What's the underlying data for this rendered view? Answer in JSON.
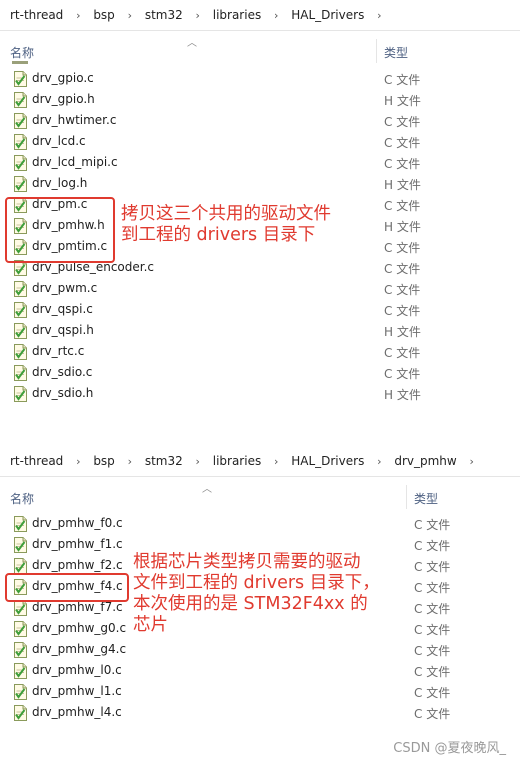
{
  "panel1": {
    "breadcrumb": [
      "rt-thread",
      "bsp",
      "stm32",
      "libraries",
      "HAL_Drivers"
    ],
    "col_name": "名称",
    "col_type": "类型",
    "files": [
      {
        "name": "drv_gpio.c",
        "type": "C 文件"
      },
      {
        "name": "drv_gpio.h",
        "type": "H 文件"
      },
      {
        "name": "drv_hwtimer.c",
        "type": "C 文件"
      },
      {
        "name": "drv_lcd.c",
        "type": "C 文件"
      },
      {
        "name": "drv_lcd_mipi.c",
        "type": "C 文件"
      },
      {
        "name": "drv_log.h",
        "type": "H 文件"
      },
      {
        "name": "drv_pm.c",
        "type": "C 文件"
      },
      {
        "name": "drv_pmhw.h",
        "type": "H 文件"
      },
      {
        "name": "drv_pmtim.c",
        "type": "C 文件"
      },
      {
        "name": "drv_pulse_encoder.c",
        "type": "C 文件"
      },
      {
        "name": "drv_pwm.c",
        "type": "C 文件"
      },
      {
        "name": "drv_qspi.c",
        "type": "C 文件"
      },
      {
        "name": "drv_qspi.h",
        "type": "H 文件"
      },
      {
        "name": "drv_rtc.c",
        "type": "C 文件"
      },
      {
        "name": "drv_sdio.c",
        "type": "C 文件"
      },
      {
        "name": "drv_sdio.h",
        "type": "H 文件"
      }
    ],
    "annotation": "拷贝这三个共用的驱动文件\n到工程的 drivers 目录下"
  },
  "panel2": {
    "breadcrumb": [
      "rt-thread",
      "bsp",
      "stm32",
      "libraries",
      "HAL_Drivers",
      "drv_pmhw"
    ],
    "col_name": "名称",
    "col_type": "类型",
    "files": [
      {
        "name": "drv_pmhw_f0.c",
        "type": "C 文件"
      },
      {
        "name": "drv_pmhw_f1.c",
        "type": "C 文件"
      },
      {
        "name": "drv_pmhw_f2.c",
        "type": "C 文件"
      },
      {
        "name": "drv_pmhw_f4.c",
        "type": "C 文件"
      },
      {
        "name": "drv_pmhw_f7.c",
        "type": "C 文件"
      },
      {
        "name": "drv_pmhw_g0.c",
        "type": "C 文件"
      },
      {
        "name": "drv_pmhw_g4.c",
        "type": "C 文件"
      },
      {
        "name": "drv_pmhw_l0.c",
        "type": "C 文件"
      },
      {
        "name": "drv_pmhw_l1.c",
        "type": "C 文件"
      },
      {
        "name": "drv_pmhw_l4.c",
        "type": "C 文件"
      }
    ],
    "annotation": "根据芯片类型拷贝需要的驱动\n文件到工程的 drivers 目录下，\n本次使用的是 STM32F4xx 的\n芯片"
  },
  "watermark": "CSDN @夏夜晚风_",
  "colors": {
    "annotation_red": "#e03a2f",
    "file_icon_bg": "#fffbe5",
    "file_icon_border": "#8a9a5b",
    "checkmark_green": "#3e9e3a"
  },
  "icons": {
    "file": "c-source-file-icon",
    "sort": "sort-ascending-icon",
    "separator": "chevron-right-icon"
  }
}
